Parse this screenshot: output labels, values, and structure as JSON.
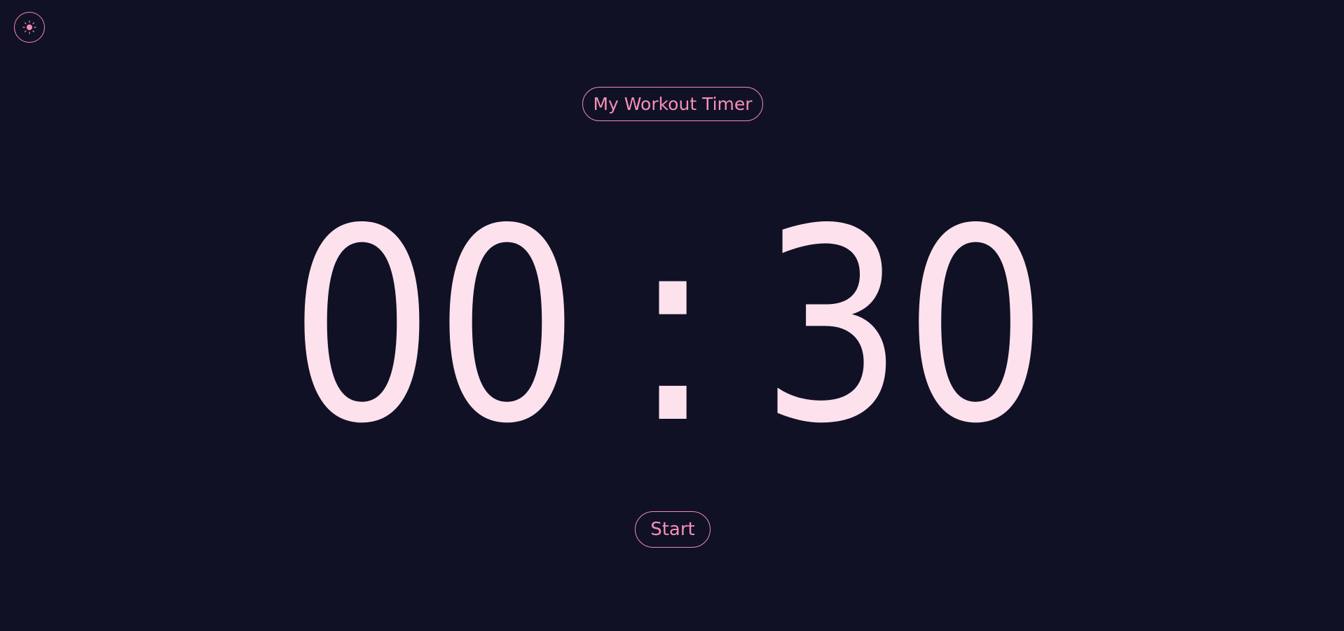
{
  "header": {
    "theme_toggle_icon": "sun-icon"
  },
  "timer": {
    "title": "My Workout Timer",
    "minutes": "00",
    "separator": ":",
    "seconds": "30"
  },
  "controls": {
    "start_label": "Start"
  },
  "colors": {
    "background": "#111126",
    "accent": "#f08cb3",
    "digits": "#fde1ec"
  }
}
